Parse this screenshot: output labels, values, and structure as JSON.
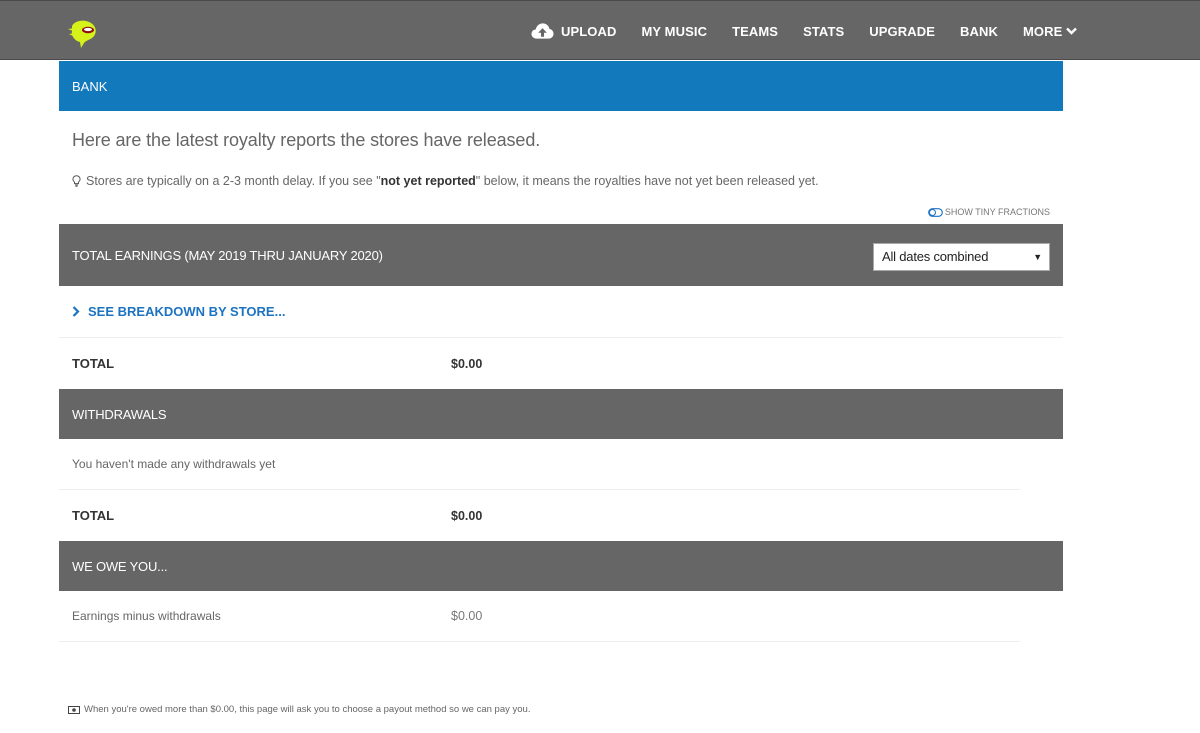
{
  "nav": {
    "upload": "UPLOAD",
    "my_music": "MY MUSIC",
    "teams": "TEAMS",
    "stats": "STATS",
    "upgrade": "UPGRADE",
    "bank": "BANK",
    "more": "MORE"
  },
  "page": {
    "header": "BANK",
    "intro": "Here are the latest royalty reports the stores have released.",
    "tip_before": "Stores are typically on a 2-3 month delay. If you see \"",
    "tip_strong": "not yet reported",
    "tip_after": "\" below, it means the royalties have not yet been released yet.",
    "tiny_fractions": "SHOW TINY FRACTIONS"
  },
  "earnings": {
    "title": "TOTAL EARNINGS (MAY 2019 THRU JANUARY 2020)",
    "date_select": "All dates combined",
    "breakdown_link": "SEE BREAKDOWN BY STORE...",
    "total_label": "TOTAL",
    "total_value": "$0.00"
  },
  "withdrawals": {
    "title": "WITHDRAWALS",
    "empty": "You haven't made any withdrawals yet",
    "total_label": "TOTAL",
    "total_value": "$0.00"
  },
  "owe": {
    "title": "WE OWE YOU...",
    "label": "Earnings minus withdrawals",
    "value": "$0.00"
  },
  "footnote": "When you're owed more than $0.00, this page will ask you to choose a payout method so we can pay you.",
  "colors": {
    "nav_bg": "#666666",
    "header_blue": "#1279bd",
    "link_blue": "#1c73c1",
    "logo_green": "#d7f21a"
  }
}
